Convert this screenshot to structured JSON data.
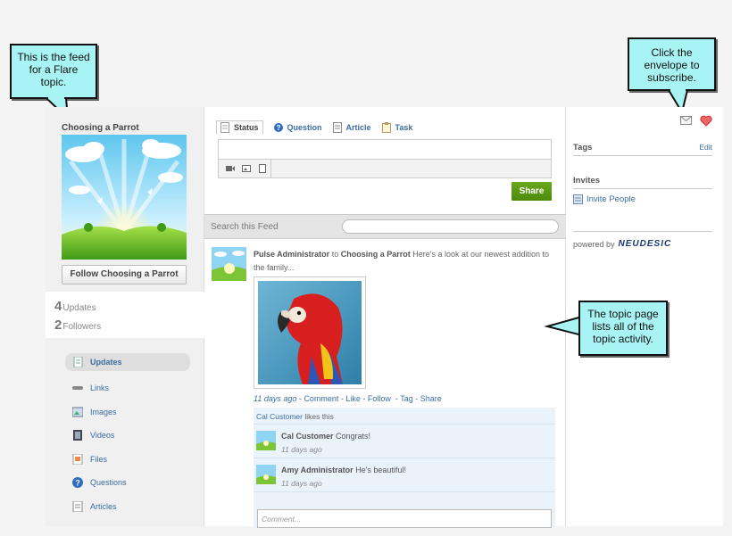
{
  "callouts": {
    "feed": "This is the feed for a Flare topic.",
    "envelope": "Click the envelope to subscribe.",
    "topic_page": "The topic page lists all of the topic activity."
  },
  "topic": {
    "title": "Choosing a Parrot",
    "follow_label": "Follow Choosing a Parrot",
    "updates_count": "4",
    "updates_label": "Updates",
    "followers_count": "2",
    "followers_label": "Followers"
  },
  "nav": {
    "items": [
      {
        "label": "Updates",
        "icon": "updates-icon"
      },
      {
        "label": "Links",
        "icon": "links-icon"
      },
      {
        "label": "Images",
        "icon": "images-icon"
      },
      {
        "label": "Videos",
        "icon": "videos-icon"
      },
      {
        "label": "Files",
        "icon": "files-icon"
      },
      {
        "label": "Questions",
        "icon": "questions-icon"
      },
      {
        "label": "Articles",
        "icon": "articles-icon"
      }
    ]
  },
  "composer": {
    "tabs": [
      "Status",
      "Question",
      "Article",
      "Task"
    ],
    "share_label": "Share"
  },
  "search": {
    "label": "Search this Feed"
  },
  "feed": {
    "author": "Pulse Administrator",
    "connector": " to ",
    "target": "Choosing a Parrot",
    "message": " Here's a look at our newest addition to the family...",
    "time": "11 days ago",
    "actions": [
      "Comment",
      "Like",
      "Follow",
      "Tag",
      "Share"
    ],
    "liker": "Cal Customer",
    "likes_text": " likes this",
    "comments": [
      {
        "author": "Cal Customer",
        "text": " Congrats!",
        "time": "11 days ago"
      },
      {
        "author": "Amy Administrator",
        "text": " He's beautiful!",
        "time": "11 days ago"
      }
    ],
    "comment_placeholder": "Comment..."
  },
  "sidebar": {
    "tags_title": "Tags",
    "edit_label": "Edit",
    "invites_title": "Invites",
    "invite_label": "Invite People",
    "powered_label": "powered by",
    "brand": "NEUDESIC"
  },
  "colors": {
    "link": "#3b6ea5",
    "share_green": "#5a9a12",
    "callout_bg": "#a8f3f3"
  }
}
